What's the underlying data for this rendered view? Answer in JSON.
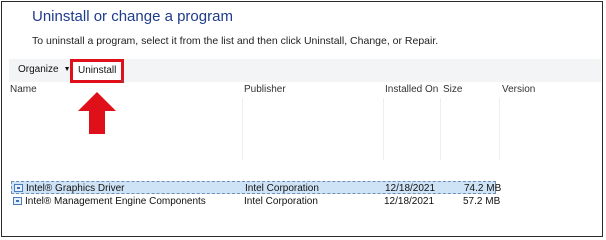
{
  "page": {
    "title": "Uninstall or change a program",
    "subtitle": "To uninstall a program, select it from the list and then click Uninstall, Change, or Repair."
  },
  "toolbar": {
    "organize_label": "Organize",
    "organize_caret": "▼",
    "uninstall_label": "Uninstall"
  },
  "columns": {
    "name": "Name",
    "publisher": "Publisher",
    "installed_on": "Installed On",
    "size": "Size",
    "version": "Version",
    "sort_indicator": "^"
  },
  "programs": [
    {
      "name": "Intel® Graphics Driver",
      "publisher": "Intel Corporation",
      "installed_on": "12/18/2021",
      "size": "74.2 MB",
      "version": "",
      "selected": true
    },
    {
      "name": "Intel® Management Engine Components",
      "publisher": "Intel Corporation",
      "installed_on": "12/18/2021",
      "size": "57.2 MB",
      "version": "",
      "selected": false
    }
  ],
  "annotation": {
    "highlight_color": "#e0101a",
    "arrow_icon": "arrow-up-icon"
  }
}
